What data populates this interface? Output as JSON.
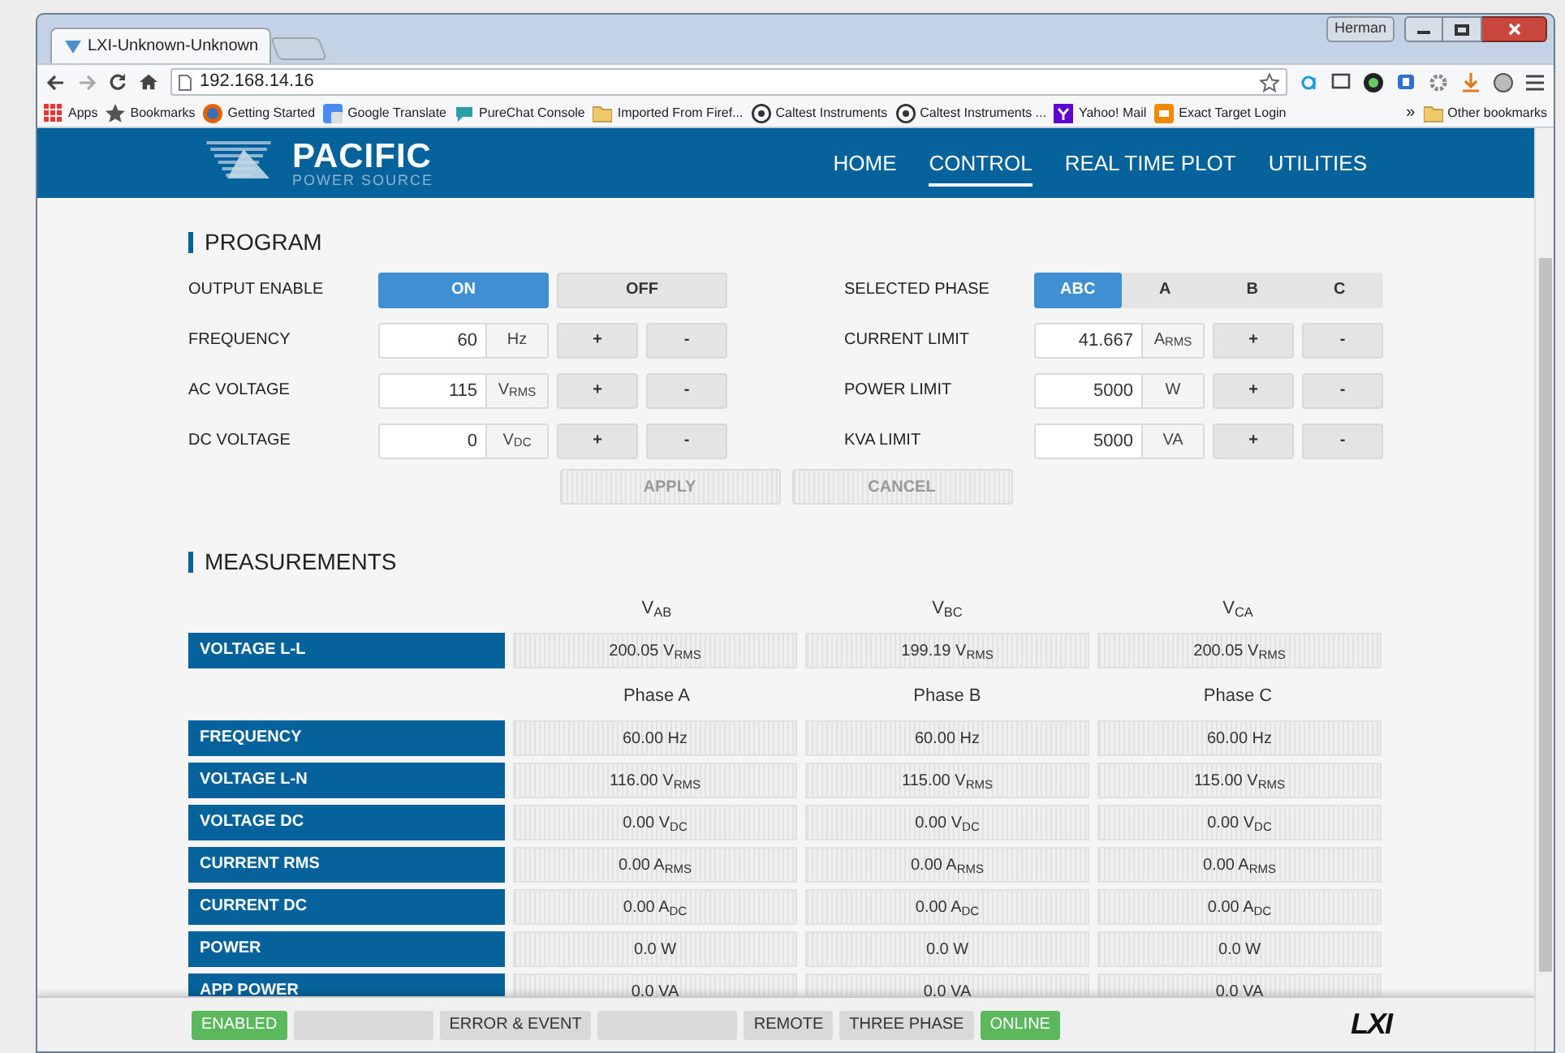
{
  "browser": {
    "user": "Herman",
    "tabs": [
      {
        "label": "LXI-Unknown-Unknown",
        "selected": true
      }
    ],
    "address": "192.168.14.16",
    "bookmarks": [
      {
        "kind": "apps",
        "label": "Apps"
      },
      {
        "kind": "star",
        "label": "Bookmarks"
      },
      {
        "kind": "firefox",
        "label": "Getting Started"
      },
      {
        "kind": "translate",
        "label": "Google Translate"
      },
      {
        "kind": "chat",
        "label": "PureChat Console"
      },
      {
        "kind": "folder",
        "label": "Imported From Firef..."
      },
      {
        "kind": "caltest",
        "label": "Caltest Instruments"
      },
      {
        "kind": "caltest",
        "label": "Caltest Instruments ..."
      },
      {
        "kind": "yahoo",
        "label": "Yahoo! Mail"
      },
      {
        "kind": "exact",
        "label": "Exact Target Login"
      }
    ],
    "more": "»",
    "other": "Other bookmarks"
  },
  "header": {
    "logo_title": "PACIFIC",
    "logo_subtitle": "POWER SOURCE",
    "nav": [
      {
        "label": "HOME",
        "selected": false
      },
      {
        "label": "CONTROL",
        "selected": true
      },
      {
        "label": "REAL TIME PLOT",
        "selected": false
      },
      {
        "label": "UTILITIES",
        "selected": false
      }
    ]
  },
  "program": {
    "title": "PROGRAM",
    "left_rows": [
      {
        "kind": "toggle",
        "label": "OUTPUT ENABLE",
        "options": [
          {
            "label": "ON",
            "selected": true
          },
          {
            "label": "OFF",
            "selected": false
          }
        ]
      },
      {
        "kind": "field",
        "label": "FREQUENCY",
        "value": "60",
        "unit": "Hz",
        "plus": "+",
        "minus": "-"
      },
      {
        "kind": "field",
        "label": "AC VOLTAGE",
        "value": "115",
        "unit": "V$_{RMS}$",
        "plus": "+",
        "minus": "-"
      },
      {
        "kind": "field",
        "label": "DC VOLTAGE",
        "value": "0",
        "unit": "V$_{DC}$",
        "plus": "+",
        "minus": "-"
      }
    ],
    "right_rows": [
      {
        "kind": "segments",
        "label": "SELECTED PHASE",
        "options": [
          {
            "label": "ABC",
            "selected": true
          },
          {
            "label": "A",
            "selected": false
          },
          {
            "label": "B",
            "selected": false
          },
          {
            "label": "C",
            "selected": false
          }
        ]
      },
      {
        "kind": "field",
        "label": "CURRENT LIMIT",
        "value": "41.667",
        "unit": "A$_{RMS}$",
        "plus": "+",
        "minus": "-"
      },
      {
        "kind": "field",
        "label": "POWER LIMIT",
        "value": "5000",
        "unit": "W",
        "plus": "+",
        "minus": "-"
      },
      {
        "kind": "field",
        "label": "KVA LIMIT",
        "value": "5000",
        "unit": "VA",
        "plus": "+",
        "minus": "-"
      }
    ],
    "actions": [
      {
        "label": "APPLY",
        "disabled": true
      },
      {
        "label": "CANCEL",
        "disabled": true
      }
    ]
  },
  "measurements": {
    "title": "MEASUREMENTS",
    "groups": [
      {
        "headers": [
          "V$_{AB}$",
          "V$_{BC}$",
          "V$_{CA}$"
        ],
        "rows": [
          {
            "label": "VOLTAGE L-L",
            "values": [
              "200.05 V$_{RMS}$",
              "199.19 V$_{RMS}$",
              "200.05 V$_{RMS}$"
            ]
          }
        ]
      },
      {
        "headers": [
          "Phase A",
          "Phase B",
          "Phase C"
        ],
        "rows": [
          {
            "label": "FREQUENCY",
            "values": [
              "60.00 Hz",
              "60.00 Hz",
              "60.00 Hz"
            ]
          },
          {
            "label": "VOLTAGE L-N",
            "values": [
              "116.00 V$_{RMS}$",
              "115.00 V$_{RMS}$",
              "115.00 V$_{RMS}$"
            ]
          },
          {
            "label": "VOLTAGE DC",
            "values": [
              "0.00 V$_{DC}$",
              "0.00 V$_{DC}$",
              "0.00 V$_{DC}$"
            ]
          },
          {
            "label": "CURRENT RMS",
            "values": [
              "0.00 A$_{RMS}$",
              "0.00 A$_{RMS}$",
              "0.00 A$_{RMS}$"
            ]
          },
          {
            "label": "CURRENT DC",
            "values": [
              "0.00 A$_{DC}$",
              "0.00 A$_{DC}$",
              "0.00 A$_{DC}$"
            ]
          },
          {
            "label": "POWER",
            "values": [
              "0.0 W",
              "0.0 W",
              "0.0 W"
            ]
          },
          {
            "label": "APP POWER",
            "values": [
              "0.0 VA",
              "0.0 VA",
              "0.0 VA"
            ]
          }
        ]
      }
    ]
  },
  "status_bar": {
    "indicators": [
      {
        "label": "ENABLED",
        "on": true
      },
      {
        "on": false
      },
      {
        "label": "ERROR & EVENT",
        "on": false
      },
      {
        "on": false
      },
      {
        "label": "REMOTE",
        "on": false
      },
      {
        "label": "THREE PHASE",
        "on": false
      },
      {
        "label": "ONLINE",
        "on": true
      }
    ],
    "logo": "LXI"
  }
}
